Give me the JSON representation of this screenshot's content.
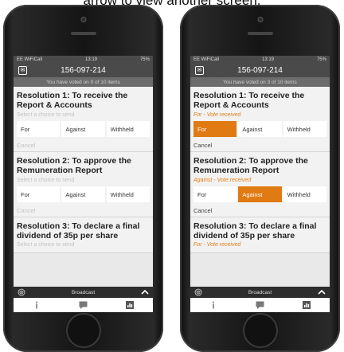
{
  "caption": "arrow to view another screen.",
  "phones": [
    {
      "status": {
        "carrier": "EE WiFiCall",
        "time": "13:19",
        "battery": "75%"
      },
      "header_title": "156-097-214",
      "voted_banner": "You have voted on 0 of 10 items",
      "resolutions": [
        {
          "title": "Resolution 1: To receive the Report & Accounts",
          "status": "Select a choice to send",
          "choices": [
            "For",
            "Against",
            "Withheld"
          ],
          "cancel": "Cancel"
        },
        {
          "title": "Resolution 2: To approve the Remuneration Report",
          "status": "Select a choice to send",
          "choices": [
            "For",
            "Against",
            "Withheld"
          ],
          "cancel": "Cancel"
        },
        {
          "title": "Resolution 3: To declare a final dividend of 35p per share",
          "status": "Select a choice to send"
        }
      ],
      "broadcast_label": "Broadcast"
    },
    {
      "status": {
        "carrier": "EE WiFiCall",
        "time": "13:19",
        "battery": "75%"
      },
      "header_title": "156-097-214",
      "voted_banner": "You have voted on 3 of 10 items",
      "resolutions": [
        {
          "title": "Resolution 1: To receive the Report & Accounts",
          "status": "For - Vote received",
          "choices": [
            "For",
            "Against",
            "Withheld"
          ],
          "cancel": "Cancel"
        },
        {
          "title": "Resolution 2: To approve the Remuneration Report",
          "status": "Against - Vote received",
          "choices": [
            "For",
            "Against",
            "Withheld"
          ],
          "cancel": "Cancel"
        },
        {
          "title": "Resolution 3: To declare a final dividend of 35p per share",
          "status": "For - Vote received"
        }
      ],
      "broadcast_label": "Broadcast"
    }
  ],
  "colors": {
    "accent": "#e07a12",
    "header": "#4a4a4a",
    "banner": "#6c6c6c"
  },
  "icons": {
    "app": "app-logo-icon",
    "broadcast": "broadcast-antenna-icon",
    "collapse": "chevron-up-icon",
    "tabs": [
      "info-icon",
      "chat-icon",
      "chart-icon"
    ]
  }
}
